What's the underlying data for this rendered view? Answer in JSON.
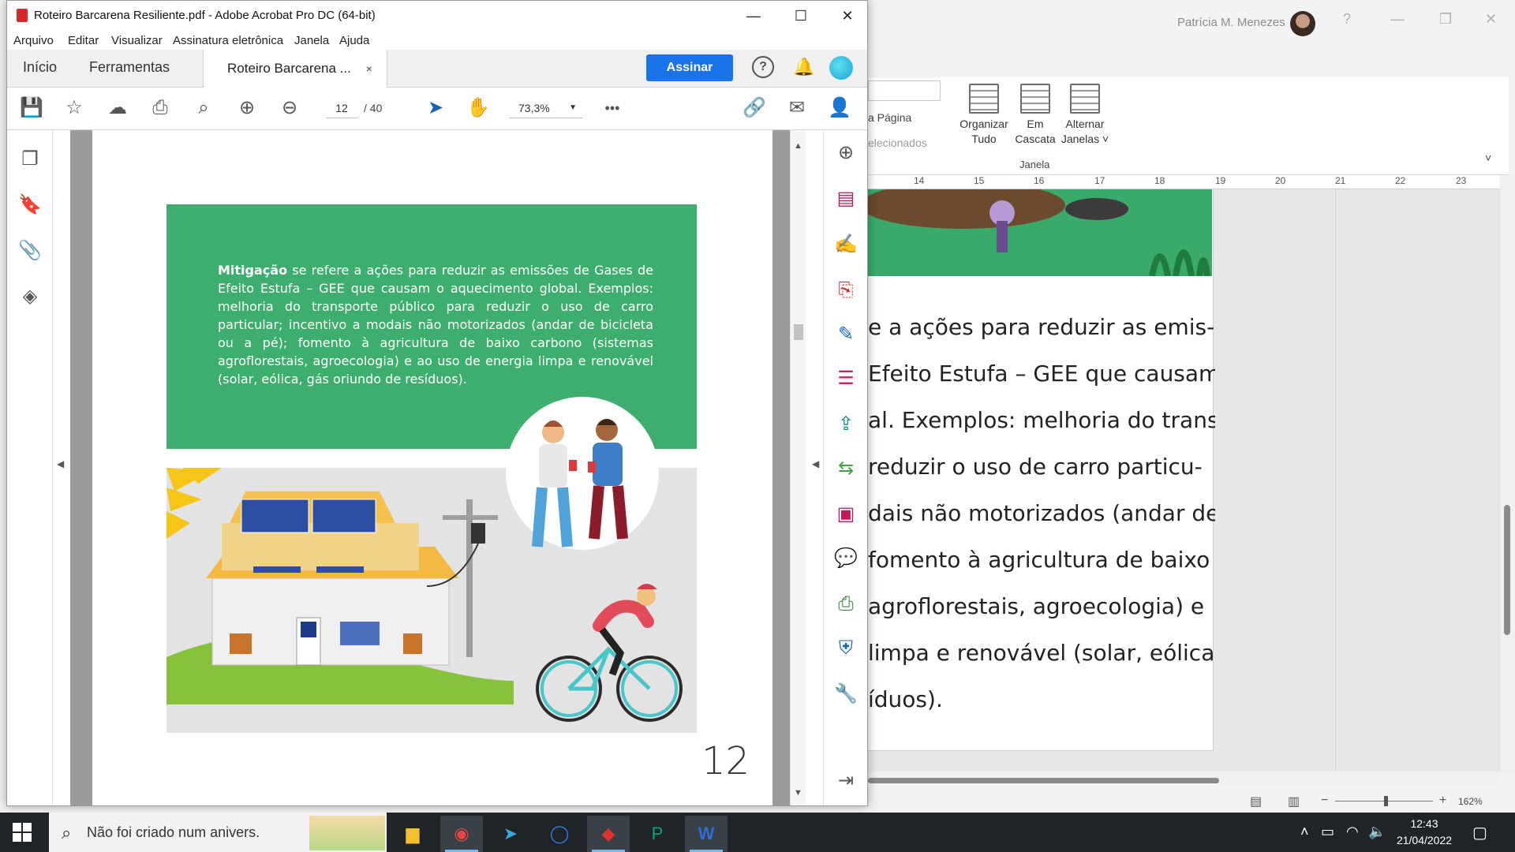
{
  "word": {
    "user_name": "Patrícia M. Menezes",
    "help_icon": "?",
    "ribbon": {
      "page_label": "a Página",
      "selected_label": "elecionados",
      "buttons": [
        {
          "line1": "Organizar",
          "line2": "Tudo"
        },
        {
          "line1": "Em",
          "line2": "Cascata"
        },
        {
          "line1": "Alternar",
          "line2": "Janelas ˅"
        }
      ],
      "group_label": "Janela"
    },
    "ruler_ticks": [
      "14",
      "15",
      "16",
      "17",
      "18",
      "19",
      "20",
      "21",
      "22",
      "23"
    ],
    "doc_lines": [
      "e a ações para reduzir as emis-",
      "Efeito Estufa – GEE que causam o",
      "al. Exemplos: melhoria do trans-",
      "reduzir o uso de carro particu-",
      "dais não motorizados (andar de",
      "fomento à agricultura de baixo",
      "agroflorestais, agroecologia) e",
      "limpa e renovável (solar, eólica,",
      "íduos)."
    ],
    "zoom": "162%"
  },
  "acrobat": {
    "window_title": "Roteiro Barcarena Resiliente.pdf - Adobe Acrobat Pro DC (64-bit)",
    "menu": [
      "Arquivo",
      "Editar",
      "Visualizar",
      "Assinatura eletrônica",
      "Janela",
      "Ajuda"
    ],
    "tabs": {
      "home": "Início",
      "tools": "Ferramentas",
      "document": "Roteiro Barcarena ...",
      "close": "×"
    },
    "sign_button": "Assinar",
    "toolbar": {
      "page_current": "12",
      "page_total": "/ 40",
      "zoom": "73,3%",
      "more": "•••"
    },
    "document": {
      "heading": "Mitigação",
      "text": " se refere a ações para reduzir as emissões de Gases de Efeito Estufa – GEE que causam o aquecimento global. Exemplos: melhoria do transporte público para reduzir o uso de carro particular; incentivo a modais não motorizados (andar de bicicleta ou a pé); fomento à agricultura de baixo carbono (sistemas agroflorestais, agroecologia) e ao uso de energia limpa e renovável (solar, eólica, gás oriundo de resíduos).",
      "page_number": "12"
    }
  },
  "taskbar": {
    "search_text": "Não foi criado num anivers.",
    "time": "12:43",
    "date": "21/04/2022"
  }
}
